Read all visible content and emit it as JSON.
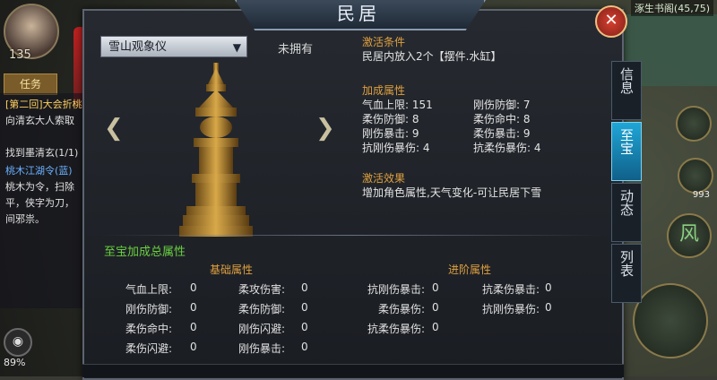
{
  "hud": {
    "level": "135",
    "quest_tab": "任务",
    "quests": [
      {
        "text": "[第二回]大会折桃",
        "style": "hot"
      },
      {
        "text": "向清玄大人索取",
        "style": "norm"
      },
      {
        "text": "找到墨清玄(1/1)",
        "style": "norm"
      },
      {
        "text": "桃木江湖令(蓝)",
        "style": "blue"
      },
      {
        "text": "桃木为令，扫除",
        "style": "norm"
      },
      {
        "text": "平，侠字为刀，",
        "style": "norm"
      },
      {
        "text": "间邪祟。",
        "style": "norm"
      }
    ],
    "battery": "89%",
    "minimap_coords": "涿生书阁(45,75)",
    "wind_skill": "风",
    "right_count": "993"
  },
  "dialog": {
    "title": "民居",
    "close_symbol": "✕",
    "selected_item": "雪山观象仪",
    "owned_status": "未拥有",
    "activation_condition": {
      "title": "激活条件",
      "text": "民居内放入2个【摆件.水缸】"
    },
    "bonus": {
      "title": "加成属性",
      "stats": [
        {
          "label": "气血上限",
          "value": "151"
        },
        {
          "label": "刚伤防御",
          "value": "7"
        },
        {
          "label": "柔伤防御",
          "value": "8"
        },
        {
          "label": "柔伤命中",
          "value": "8"
        },
        {
          "label": "刚伤暴击",
          "value": "9"
        },
        {
          "label": "柔伤暴击",
          "value": "9"
        },
        {
          "label": "抗刚伤暴伤",
          "value": "4"
        },
        {
          "label": "抗柔伤暴伤",
          "value": "4"
        }
      ]
    },
    "effect": {
      "title": "激活效果",
      "text": "增加角色属性,天气变化-可让民居下雪"
    },
    "tabs": [
      {
        "label": "信息",
        "active": false
      },
      {
        "label": "至宝",
        "active": true
      },
      {
        "label": "动态",
        "active": false
      },
      {
        "label": "列表",
        "active": false
      }
    ],
    "totals": {
      "title": "至宝加成总属性",
      "basic_header": "基础属性",
      "advanced_header": "进阶属性",
      "basic": [
        {
          "label": "气血上限:",
          "value": "0"
        },
        {
          "label": "柔攻伤害:",
          "value": "0"
        },
        {
          "label": "刚伤防御:",
          "value": "0"
        },
        {
          "label": "柔伤防御:",
          "value": "0"
        },
        {
          "label": "柔伤命中:",
          "value": "0"
        },
        {
          "label": "刚伤闪避:",
          "value": "0"
        },
        {
          "label": "柔伤闪避:",
          "value": "0"
        },
        {
          "label": "刚伤暴击:",
          "value": "0"
        }
      ],
      "advanced": [
        {
          "label": "抗刚伤暴击:",
          "value": "0"
        },
        {
          "label": "抗柔伤暴击:",
          "value": "0"
        },
        {
          "label": "柔伤暴伤:",
          "value": "0"
        },
        {
          "label": "抗刚伤暴伤:",
          "value": "0"
        },
        {
          "label": "抗柔伤暴伤:",
          "value": "0"
        }
      ]
    }
  }
}
